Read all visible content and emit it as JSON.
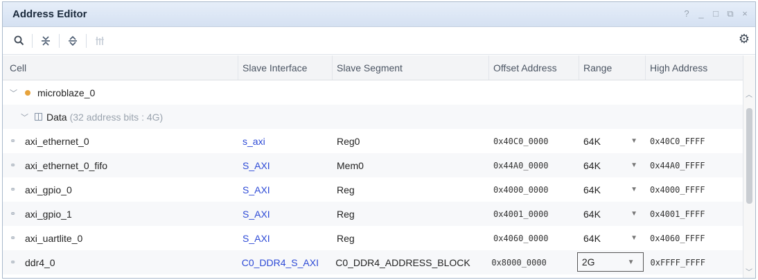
{
  "window": {
    "title": "Address Editor",
    "controls": [
      "?",
      "_",
      "□",
      "⧉",
      "×"
    ]
  },
  "toolbar": {
    "icons": [
      "search-icon",
      "collapse-all-icon",
      "expand-all-icon",
      "auto-assign-icon",
      "settings-gear-icon"
    ]
  },
  "table": {
    "headers": {
      "cell": "Cell",
      "slave_interface": "Slave Interface",
      "slave_segment": "Slave Segment",
      "offset_address": "Offset Address",
      "range": "Range",
      "high_address": "High Address"
    },
    "master": {
      "name": "microblaze_0"
    },
    "space": {
      "name": "Data",
      "info": "(32 address bits : 4G)"
    },
    "rows": [
      {
        "cell": "axi_ethernet_0",
        "interface": "s_axi",
        "segment": "Reg0",
        "offset": "0x40C0_0000",
        "range": "64K",
        "high": "0x40C0_FFFF"
      },
      {
        "cell": "axi_ethernet_0_fifo",
        "interface": "S_AXI",
        "segment": "Mem0",
        "offset": "0x44A0_0000",
        "range": "64K",
        "high": "0x44A0_FFFF"
      },
      {
        "cell": "axi_gpio_0",
        "interface": "S_AXI",
        "segment": "Reg",
        "offset": "0x4000_0000",
        "range": "64K",
        "high": "0x4000_FFFF"
      },
      {
        "cell": "axi_gpio_1",
        "interface": "S_AXI",
        "segment": "Reg",
        "offset": "0x4001_0000",
        "range": "64K",
        "high": "0x4001_FFFF"
      },
      {
        "cell": "axi_uartlite_0",
        "interface": "S_AXI",
        "segment": "Reg",
        "offset": "0x4060_0000",
        "range": "64K",
        "high": "0x4060_FFFF"
      },
      {
        "cell": "ddr4_0",
        "interface": "C0_DDR4_S_AXI",
        "segment": "C0_DDR4_ADDRESS_BLOCK",
        "offset": "0x8000_0000",
        "range": "2G",
        "high": "0xFFFF_FFFF"
      }
    ]
  }
}
